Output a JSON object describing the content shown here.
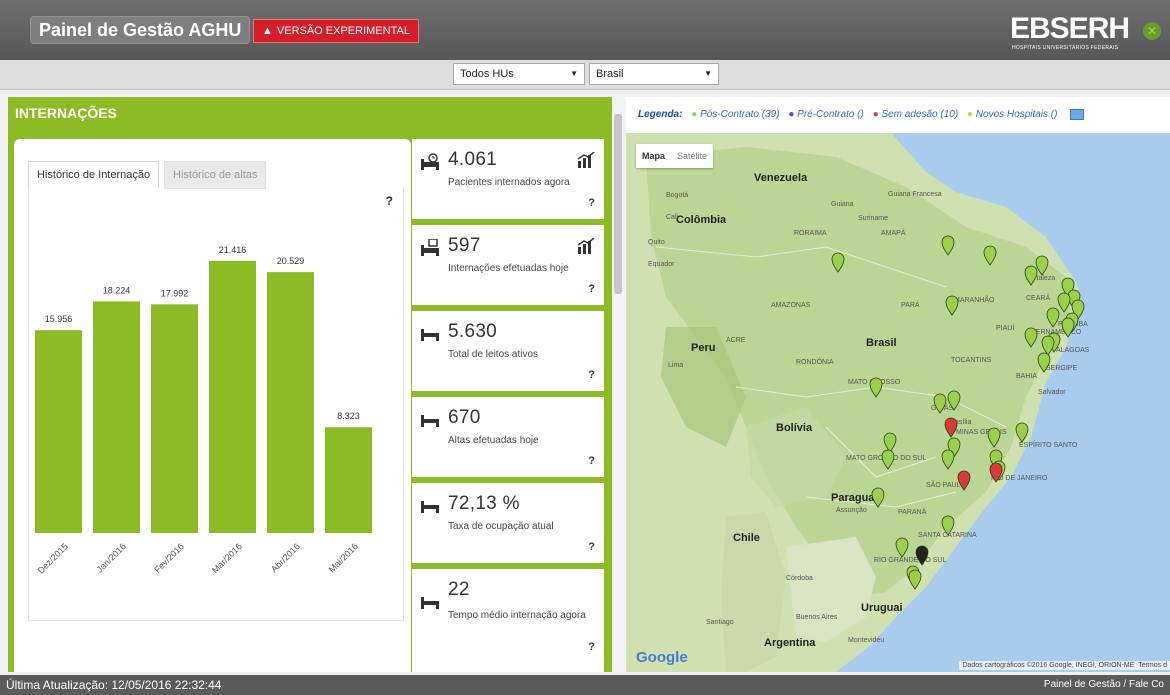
{
  "app": {
    "title": "Painel de Gestão AGHU",
    "experimental": "VERSÃO EXPERIMENTAL",
    "logo": "EBSERH",
    "logo_sub": "HOSPITAIS UNIVERSITÁRIOS FEDERAIS"
  },
  "filters": {
    "hu": "Todos HUs",
    "region": "Brasil"
  },
  "panel": {
    "title": "INTERNAÇÕES",
    "tabs": [
      "Histórico de Internação",
      "Histórico de altas"
    ],
    "help": "?"
  },
  "chart_data": {
    "type": "bar",
    "categories": [
      "Dez/2015",
      "Jan/2016",
      "Fev/2016",
      "Mar/2016",
      "Abr/2016",
      "Mai/2016"
    ],
    "values": [
      15956,
      18224,
      17992,
      21416,
      20529,
      8323
    ],
    "value_labels": [
      "15.956",
      "18.224",
      "17.992",
      "21.416",
      "20.529",
      "8.323"
    ],
    "ylim": [
      0,
      24000
    ],
    "color": "#8dbb25",
    "grid": false,
    "title": "",
    "xlabel": "",
    "ylabel": ""
  },
  "cards": [
    {
      "value": "4.061",
      "label": "Pacientes internados agora",
      "icon": "bed-clock-icon",
      "chart": true
    },
    {
      "value": "597",
      "label": "Internações efetuadas hoje",
      "icon": "bed-calendar-icon",
      "chart": true
    },
    {
      "value": "5.630",
      "label": "Total de leitos ativos",
      "icon": "bed-icon",
      "chart": false
    },
    {
      "value": "670",
      "label": "Altas efetuadas hoje",
      "icon": "bed-icon",
      "chart": false
    },
    {
      "value": "72,13 %",
      "label": "Taxa de ocupação atual",
      "icon": "bed-icon",
      "chart": false
    },
    {
      "value": "22",
      "label": "Tempo médio internação agora",
      "icon": "bed-icon",
      "chart": false
    }
  ],
  "legend": {
    "title": "Legenda:",
    "items": [
      {
        "label": "Pós-Contrato (39)",
        "color": "#9ad14b"
      },
      {
        "label": "Pré-Contrato ()",
        "color": "#4b4bd6"
      },
      {
        "label": "Sem adesão (10)",
        "color": "#d93a3a"
      },
      {
        "label": "Novos Hospitais ()",
        "color": "#f2e84a"
      }
    ]
  },
  "map": {
    "buttons": [
      "Mapa",
      "Satélite"
    ],
    "attribution": "Dados cartográficos ©2016 Google, INEGI, ORION-ME",
    "terms": "Termos d",
    "google": "Google",
    "labels": [
      {
        "text": "Venezuela",
        "x": 128,
        "y": 75,
        "strong": true
      },
      {
        "text": "Bogotá",
        "x": 40,
        "y": 95,
        "strong": false
      },
      {
        "text": "Colômbia",
        "x": 50,
        "y": 117,
        "strong": true
      },
      {
        "text": "Cali",
        "x": 40,
        "y": 117,
        "strong": false
      },
      {
        "text": "Guiana",
        "x": 205,
        "y": 104,
        "strong": false
      },
      {
        "text": "Guiana Francesa",
        "x": 262,
        "y": 94,
        "strong": false
      },
      {
        "text": "Suriname",
        "x": 232,
        "y": 118,
        "strong": false
      },
      {
        "text": "RORAIMA",
        "x": 168,
        "y": 133,
        "strong": false
      },
      {
        "text": "AMAPÁ",
        "x": 255,
        "y": 133,
        "strong": false
      },
      {
        "text": "Quito",
        "x": 22,
        "y": 142,
        "strong": false
      },
      {
        "text": "Equador",
        "x": 22,
        "y": 164,
        "strong": false
      },
      {
        "text": "AMAZONAS",
        "x": 145,
        "y": 205,
        "strong": false
      },
      {
        "text": "PARÁ",
        "x": 275,
        "y": 205,
        "strong": false
      },
      {
        "text": "MARANHÃO",
        "x": 328,
        "y": 200,
        "strong": false
      },
      {
        "text": "CEARÁ",
        "x": 400,
        "y": 198,
        "strong": false
      },
      {
        "text": "Fortaleza",
        "x": 400,
        "y": 178,
        "strong": false
      },
      {
        "text": "PIAUÍ",
        "x": 370,
        "y": 228,
        "strong": false
      },
      {
        "text": "Brasil",
        "x": 240,
        "y": 240,
        "strong": true
      },
      {
        "text": "PARAÍBA",
        "x": 432,
        "y": 224,
        "strong": false
      },
      {
        "text": "PERNAMBUCO",
        "x": 405,
        "y": 232,
        "strong": false
      },
      {
        "text": "ALAGOAS",
        "x": 430,
        "y": 250,
        "strong": false
      },
      {
        "text": "SERGIPE",
        "x": 420,
        "y": 268,
        "strong": false
      },
      {
        "text": "Peru",
        "x": 65,
        "y": 245,
        "strong": true
      },
      {
        "text": "ACRE",
        "x": 100,
        "y": 240,
        "strong": false
      },
      {
        "text": "Lima",
        "x": 42,
        "y": 265,
        "strong": false
      },
      {
        "text": "RONDÔNIA",
        "x": 170,
        "y": 262,
        "strong": false
      },
      {
        "text": "TOCANTINS",
        "x": 325,
        "y": 260,
        "strong": false
      },
      {
        "text": "BAHIA",
        "x": 390,
        "y": 276,
        "strong": false
      },
      {
        "text": "Salvador",
        "x": 412,
        "y": 292,
        "strong": false
      },
      {
        "text": "MATO GROSSO",
        "x": 222,
        "y": 282,
        "strong": false
      },
      {
        "text": "GOIÁS",
        "x": 305,
        "y": 308,
        "strong": false
      },
      {
        "text": "Brasília",
        "x": 322,
        "y": 322,
        "strong": false
      },
      {
        "text": "MINAS GERAIS",
        "x": 330,
        "y": 332,
        "strong": false
      },
      {
        "text": "Bolívia",
        "x": 150,
        "y": 325,
        "strong": true
      },
      {
        "text": "ESPÍRITO SANTO",
        "x": 393,
        "y": 345,
        "strong": false
      },
      {
        "text": "MATO GROSSO DO SUL",
        "x": 220,
        "y": 358,
        "strong": false
      },
      {
        "text": "SÃO PAULO",
        "x": 300,
        "y": 385,
        "strong": false
      },
      {
        "text": "RIO DE JANEIRO",
        "x": 365,
        "y": 378,
        "strong": false
      },
      {
        "text": "Paraguai",
        "x": 205,
        "y": 395,
        "strong": true
      },
      {
        "text": "Assunção",
        "x": 210,
        "y": 410,
        "strong": false
      },
      {
        "text": "PARANÁ",
        "x": 272,
        "y": 412,
        "strong": false
      },
      {
        "text": "SANTA CATARINA",
        "x": 292,
        "y": 435,
        "strong": false
      },
      {
        "text": "Chile",
        "x": 107,
        "y": 435,
        "strong": true
      },
      {
        "text": "RIO GRANDE DO SUL",
        "x": 248,
        "y": 460,
        "strong": false
      },
      {
        "text": "Córdoba",
        "x": 160,
        "y": 478,
        "strong": false
      },
      {
        "text": "Uruguai",
        "x": 235,
        "y": 505,
        "strong": true
      },
      {
        "text": "Santiago",
        "x": 80,
        "y": 522,
        "strong": false
      },
      {
        "text": "Buenos Aires",
        "x": 170,
        "y": 517,
        "strong": false
      },
      {
        "text": "Argentina",
        "x": 138,
        "y": 540,
        "strong": true
      },
      {
        "text": "Montevidéu",
        "x": 222,
        "y": 540,
        "strong": false
      }
    ]
  },
  "footer": {
    "updated": "Última Atualização: 12/05/2016 22:32:44",
    "links": "Painel de Gestão / Fale Co"
  }
}
